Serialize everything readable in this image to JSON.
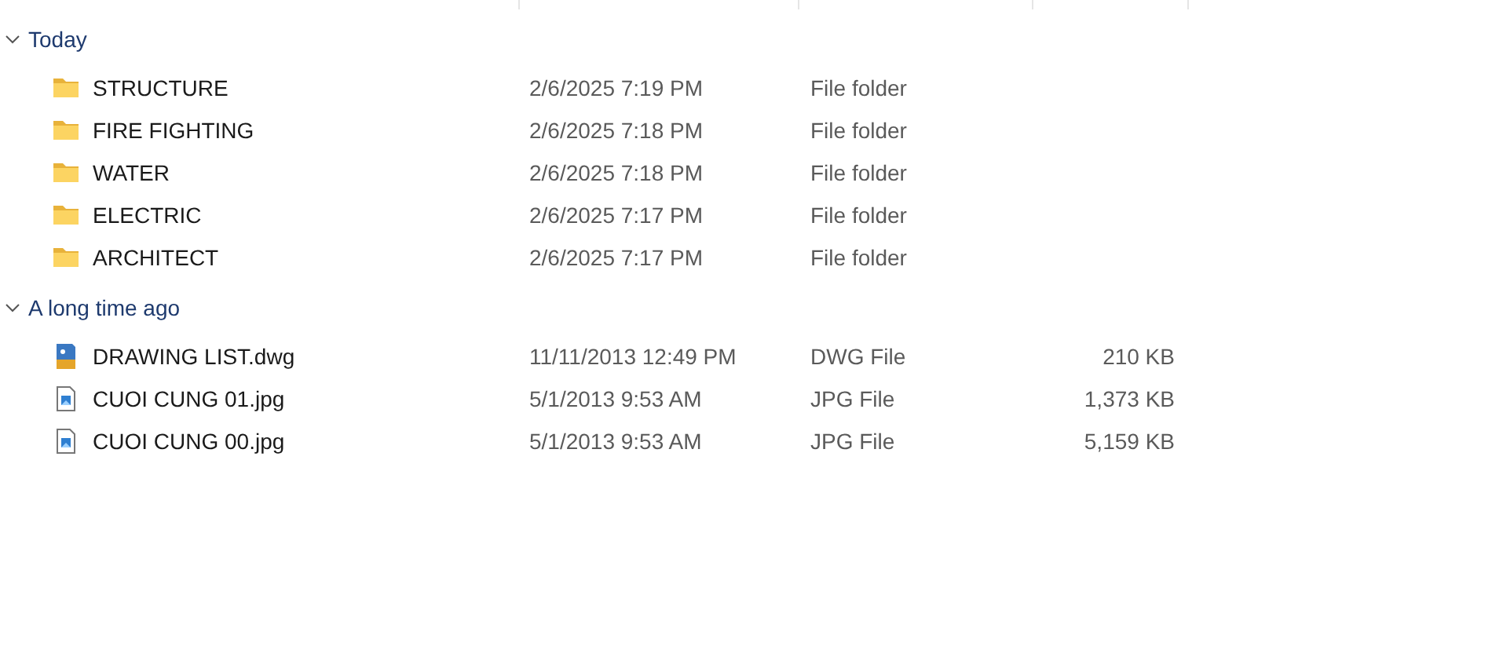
{
  "groups": [
    {
      "label": "Today",
      "expanded": true,
      "items": [
        {
          "name": "STRUCTURE",
          "kind": "folder",
          "date": "2/6/2025 7:19 PM",
          "type": "File folder"
        },
        {
          "name": "FIRE FIGHTING",
          "kind": "folder",
          "date": "2/6/2025 7:18 PM",
          "type": "File folder"
        },
        {
          "name": "WATER",
          "kind": "folder",
          "date": "2/6/2025 7:18 PM",
          "type": "File folder"
        },
        {
          "name": "ELECTRIC",
          "kind": "folder",
          "date": "2/6/2025 7:17 PM",
          "type": "File folder"
        },
        {
          "name": "ARCHITECT",
          "kind": "folder",
          "date": "2/6/2025 7:17 PM",
          "type": "File folder"
        }
      ]
    },
    {
      "label": "A long time ago",
      "expanded": true,
      "items": [
        {
          "name": "DRAWING LIST.dwg",
          "kind": "dwg",
          "date": "11/11/2013 12:49 PM",
          "type": "DWG File",
          "size": "210 KB"
        },
        {
          "name": "CUOI CUNG 01.jpg",
          "kind": "image",
          "date": "5/1/2013 9:53 AM",
          "type": "JPG File",
          "size": "1,373 KB"
        },
        {
          "name": "CUOI CUNG 00.jpg",
          "kind": "image",
          "date": "5/1/2013 9:53 AM",
          "type": "JPG File",
          "size": "5,159 KB"
        }
      ]
    }
  ]
}
